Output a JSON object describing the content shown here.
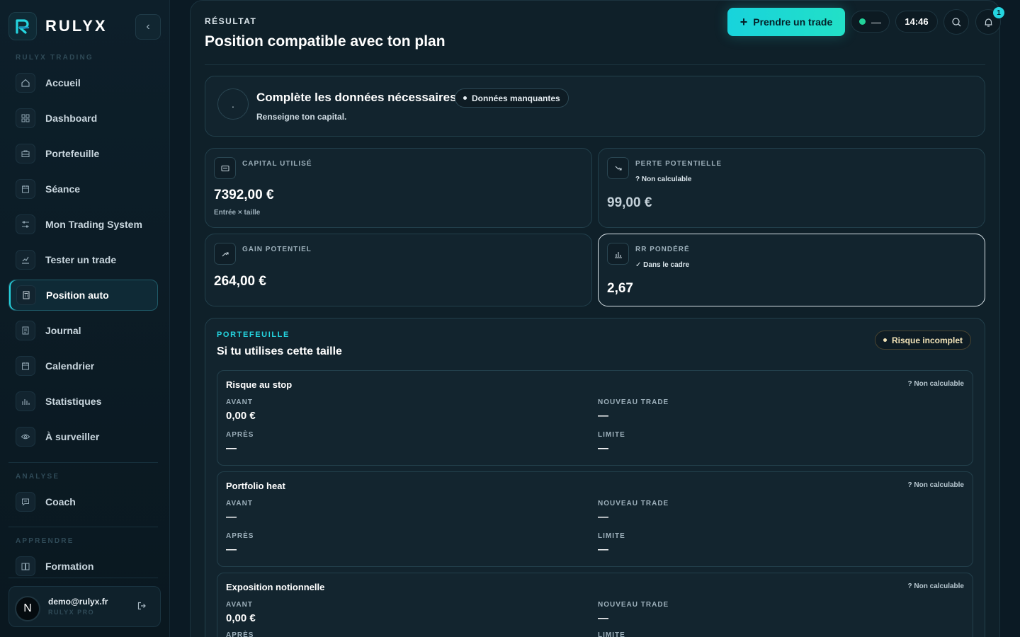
{
  "brand": {
    "name": "RULYX",
    "colors": {
      "accent": "#25d5e0",
      "success": "#22d39a",
      "warning": "#f3e4b8"
    }
  },
  "sidebar": {
    "section_trading": "RULYX TRADING",
    "section_analyse": "ANALYSE",
    "section_apprendre": "APPRENDRE",
    "items": [
      {
        "label": "Accueil",
        "icon": "home-icon"
      },
      {
        "label": "Dashboard",
        "icon": "grid-icon"
      },
      {
        "label": "Portefeuille",
        "icon": "briefcase-icon"
      },
      {
        "label": "Séance",
        "icon": "calendar-icon"
      },
      {
        "label": "Mon Trading System",
        "icon": "sliders-icon"
      },
      {
        "label": "Tester un trade",
        "icon": "chart-check-icon"
      },
      {
        "label": "Position auto",
        "icon": "calculator-icon",
        "active": true
      },
      {
        "label": "Journal",
        "icon": "notebook-icon"
      },
      {
        "label": "Calendrier",
        "icon": "calendar-icon"
      },
      {
        "label": "Statistiques",
        "icon": "bar-chart-icon"
      },
      {
        "label": "À surveiller",
        "icon": "eye-icon"
      }
    ],
    "analyse_items": [
      {
        "label": "Coach",
        "icon": "chat-icon"
      }
    ],
    "apprendre_items": [
      {
        "label": "Formation",
        "icon": "book-icon"
      }
    ],
    "user": {
      "initial": "N",
      "email": "demo@rulyx.fr",
      "plan": "RULYX PRO"
    }
  },
  "header": {
    "eyebrow": "RÉSULTAT",
    "title": "Position compatible avec ton plan",
    "cta_label": "Prendre un trade",
    "status_value": "—",
    "time": "14:46",
    "notifications": "1"
  },
  "missing": {
    "dot": ".",
    "title": "Complète les données nécessaires",
    "badge": "Données manquantes",
    "subtitle": "Renseigne ton capital."
  },
  "metrics": {
    "capital": {
      "label": "CAPITAL UTILISÉ",
      "value": "7392,00 €",
      "foot": "Entrée × taille"
    },
    "loss": {
      "label": "PERTE POTENTIELLE",
      "note": "? Non calculable",
      "value": "99,00 €"
    },
    "gain": {
      "label": "GAIN POTENTIEL",
      "value": "264,00 €"
    },
    "rr": {
      "label": "RR PONDÉRÉ",
      "note": "✓ Dans le cadre",
      "value": "2,67"
    }
  },
  "portfolio": {
    "eyebrow": "PORTEFEUILLE",
    "title": "Si tu utilises cette taille",
    "badge": "Risque incomplet",
    "labels": {
      "avant": "AVANT",
      "nouveau": "NOUVEAU TRADE",
      "apres": "APRÈS",
      "limite": "LIMITE"
    },
    "blocks": [
      {
        "title": "Risque au stop",
        "flag": "? Non calculable",
        "avant": "0,00 €",
        "nouveau": "—",
        "apres": "—",
        "limite": "—"
      },
      {
        "title": "Portfolio heat",
        "flag": "? Non calculable",
        "avant": "—",
        "nouveau": "—",
        "apres": "—",
        "limite": "—"
      },
      {
        "title": "Exposition notionnelle",
        "flag": "? Non calculable",
        "avant": "0,00 €",
        "nouveau": "—",
        "apres": "",
        "limite": ""
      }
    ]
  }
}
